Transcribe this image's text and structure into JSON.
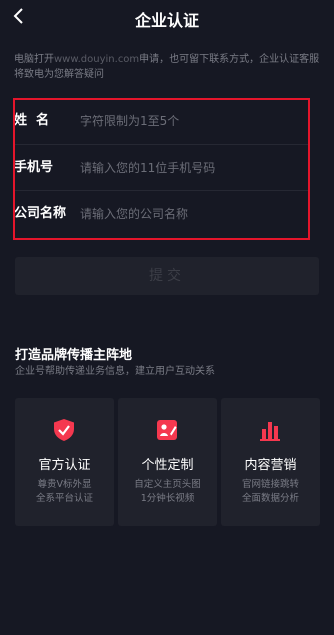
{
  "header": {
    "title": "企业认证",
    "back_icon": "chevron-left-icon"
  },
  "intro": {
    "prefix": "电脑打开",
    "url": "www.douyin.com",
    "suffix": "申请，也可留下联系方式，企业认证客服将致电为您解答疑问"
  },
  "form": {
    "rows": [
      {
        "label": "姓  名",
        "placeholder": "字符限制为1至5个",
        "value": ""
      },
      {
        "label": "手机号",
        "placeholder": "请输入您的11位手机号码",
        "value": ""
      },
      {
        "label": "公司名称",
        "placeholder": "请输入您的公司名称",
        "value": ""
      }
    ],
    "highlight_color": "#e4152b"
  },
  "submit_label": "提交",
  "section": {
    "title": "打造品牌传播主阵地",
    "subtitle": "企业号帮助传递业务信息，建立用户互动关系"
  },
  "cards": [
    {
      "icon": "shield-check-icon",
      "title": "官方认证",
      "desc1": "尊贵V标外显",
      "desc2": "全系平台认证"
    },
    {
      "icon": "edit-profile-icon",
      "title": "个性定制",
      "desc1": "自定义主页头图",
      "desc2": "1分钟长视频"
    },
    {
      "icon": "bar-chart-icon",
      "title": "内容营销",
      "desc1": "官网链接跳转",
      "desc2": "全面数据分析"
    }
  ],
  "accent_color": "#f5384f"
}
